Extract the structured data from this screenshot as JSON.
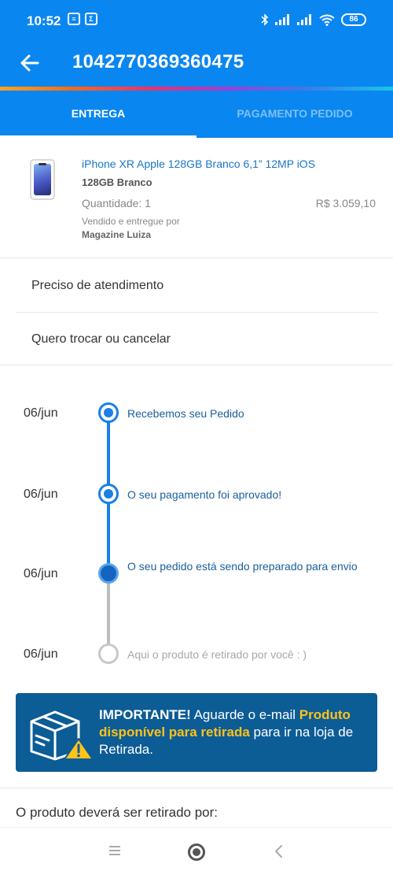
{
  "status_bar": {
    "time": "10:52",
    "battery": "86",
    "icons": [
      "notification-icon",
      "app-icon",
      "bluetooth-icon",
      "signal-icon",
      "signal-icon",
      "wifi-icon",
      "battery-icon"
    ]
  },
  "header": {
    "title": "1042770369360475",
    "back_icon": "arrow-left-icon"
  },
  "tabs": [
    {
      "label": "ENTREGA",
      "active": true
    },
    {
      "label": "PAGAMENTO PEDIDO",
      "active": false
    }
  ],
  "product": {
    "name": "iPhone XR Apple 128GB Branco 6,1” 12MP iOS",
    "variant": "128GB Branco",
    "quantity": "Quantidade: 1",
    "price": "R$ 3.059,10",
    "seller_label": "Vendido e entregue por",
    "seller": "Magazine Luiza"
  },
  "actions": [
    {
      "label": "Preciso de atendimento"
    },
    {
      "label": "Quero trocar ou cancelar"
    }
  ],
  "timeline": [
    {
      "date": "06/jun",
      "text": "Recebemos seu Pedido",
      "state": "done"
    },
    {
      "date": "06/jun",
      "text": "O seu pagamento foi aprovado!",
      "state": "done"
    },
    {
      "date": "06/jun",
      "text": "O seu pedido está sendo preparado para envio",
      "state": "current"
    },
    {
      "date": "06/jun",
      "text": "Aqui o produto é retirado por você : )",
      "state": "pending"
    }
  ],
  "notice": {
    "strong": "IMPORTANTE!",
    "text1": " Aguarde o e-mail ",
    "highlight": "Produto disponível para retirada",
    "text2": " para ir na loja de Retirada.",
    "icon": "package-warning-icon"
  },
  "pickup": {
    "label": "O produto deverá ser retirado por:"
  },
  "colors": {
    "primary": "#0a86f0",
    "notice_bg": "#0c5c96",
    "highlight": "#ffc21a",
    "timeline_blue": "#1a80e5"
  }
}
